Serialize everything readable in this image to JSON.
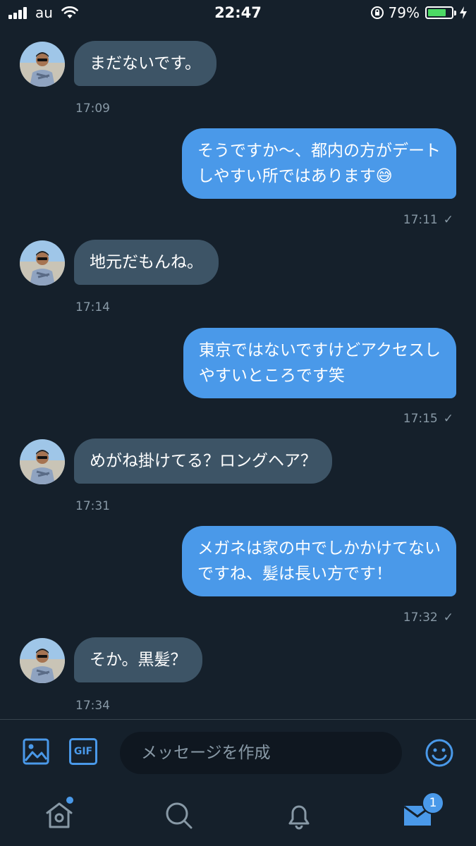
{
  "status_bar": {
    "carrier": "au",
    "time": "22:47",
    "battery_percent": "79%",
    "battery_level": 0.79,
    "battery_color": "#4cd964"
  },
  "messages": [
    {
      "direction": "in",
      "text": "まだないです。",
      "time": "17:09"
    },
    {
      "direction": "out",
      "text": "そうですか〜、都内の方がデート\nしやすい所ではあります😅",
      "time": "17:11"
    },
    {
      "direction": "in",
      "text": "地元だもんね。",
      "time": "17:14"
    },
    {
      "direction": "out",
      "text": "東京ではないですけどアクセスし\nやすいところです笑",
      "time": "17:15"
    },
    {
      "direction": "in",
      "text": "めがね掛けてる？ロングヘア？",
      "time": "17:31"
    },
    {
      "direction": "out",
      "text": "メガネは家の中でしかかけてない\nですね、髪は長い方です！",
      "time": "17:32"
    },
    {
      "direction": "in",
      "text": "そか。黒髪？",
      "time": "17:34"
    }
  ],
  "composer": {
    "image_icon": "image-icon",
    "gif_label": "GIF",
    "placeholder": "メッセージを作成",
    "emoji_icon": "emoji-icon"
  },
  "tab_bar": {
    "home_icon": "home-icon",
    "search_icon": "search-icon",
    "notifications_icon": "bell-icon",
    "messages_icon": "mail-icon",
    "messages_badge": "1"
  },
  "colors": {
    "background": "#15202b",
    "incoming_bubble": "#3d5466",
    "outgoing_bubble": "#4a99e9",
    "accent": "#4a99e9",
    "timestamp": "#8899a6"
  }
}
